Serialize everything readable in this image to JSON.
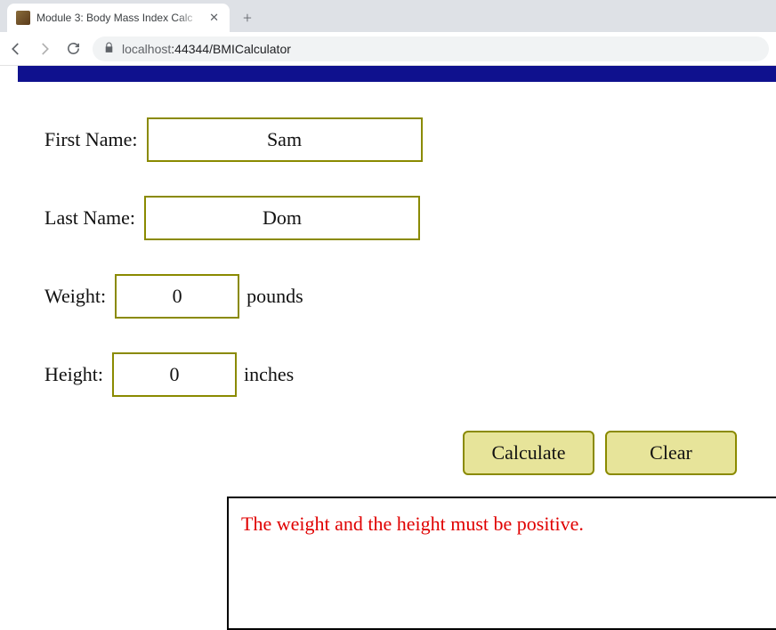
{
  "browser": {
    "tab_title": "Module 3: Body Mass Index Calc",
    "url_host": "localhost",
    "url_port_path": ":44344/BMICalculator"
  },
  "form": {
    "first_name_label": "First Name:",
    "first_name_value": "Sam",
    "last_name_label": "Last Name:",
    "last_name_value": "Dom",
    "weight_label": "Weight:",
    "weight_value": "0",
    "weight_unit": "pounds",
    "height_label": "Height:",
    "height_value": "0",
    "height_unit": "inches"
  },
  "buttons": {
    "calculate": "Calculate",
    "clear": "Clear"
  },
  "output": {
    "message": "The weight and the height must be positive."
  }
}
